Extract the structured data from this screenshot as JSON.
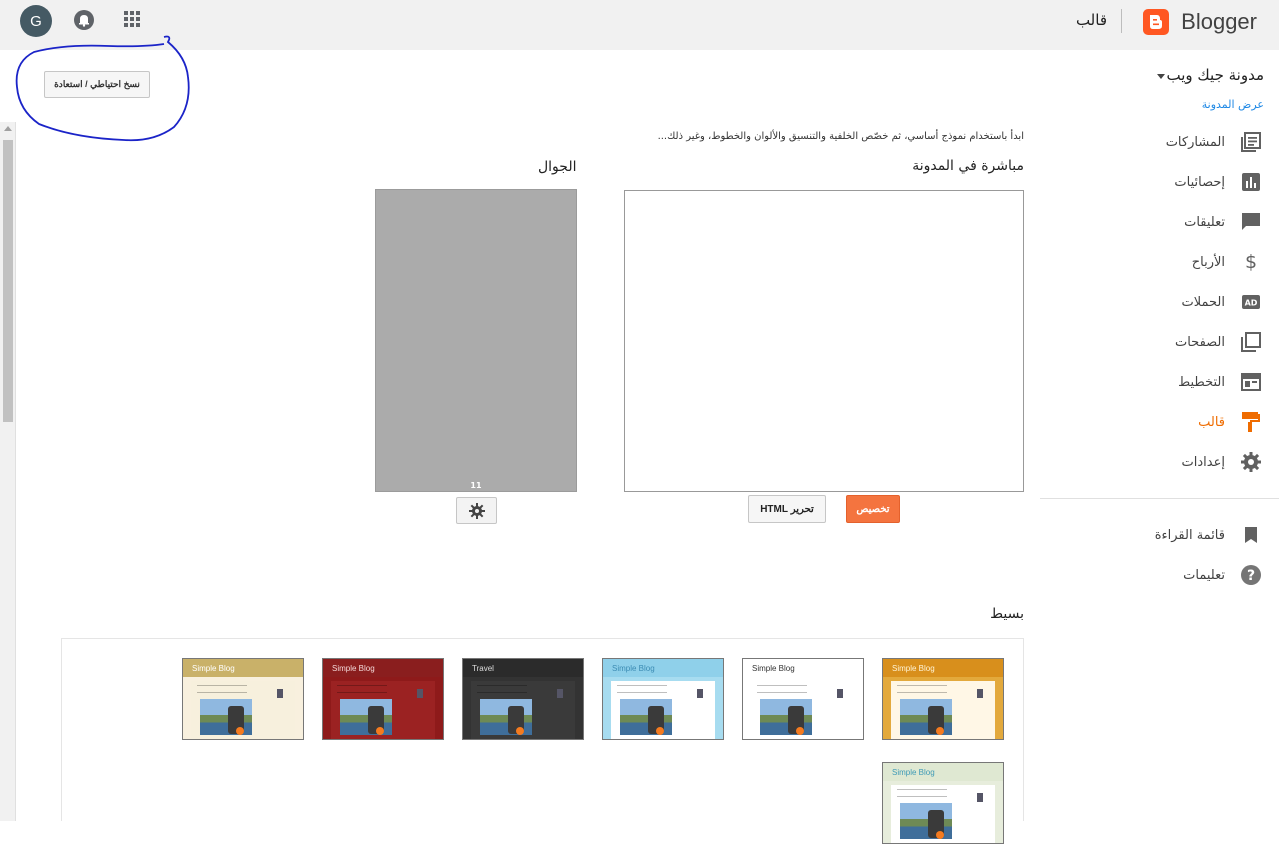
{
  "header": {
    "avatar_letter": "G",
    "brand": "Blogger",
    "page_title": "قالب"
  },
  "main": {
    "backup_button": "نسخ احتياطي / استعادة",
    "intro": "ابدأ باستخدام نموذج أساسي، ثم خصّص الخلفية والتنسيق والألوان والخطوط، وغير ذلك...",
    "live_title": "مباشرة في المدونة",
    "mobile_title": "الجوال",
    "mobile_page_number": "11",
    "customize_button": "تخصيص",
    "edit_html_button": "تحرير HTML",
    "simple_title": "بسيط"
  },
  "templates": [
    {
      "title": "Simple Blog",
      "head": "#c9b169",
      "body": "#f7f0dd",
      "page": "#f8f0de",
      "text": "#ffffff"
    },
    {
      "title": "Simple Blog",
      "head": "#8a1e1e",
      "body": "#9b2222",
      "page": "#8e1a1a",
      "text": "#f3d8d8"
    },
    {
      "title": "Travel",
      "head": "#2b2b2b",
      "body": "#3a3a3a",
      "page": "#333333",
      "text": "#dddddd"
    },
    {
      "title": "Simple Blog",
      "head": "#8fd0ea",
      "body": "#ffffff",
      "page": "#a7dcf0",
      "text": "#3c8cb4"
    },
    {
      "title": "Simple Blog",
      "head": "#ffffff",
      "body": "#ffffff",
      "page": "#ffffff",
      "text": "#333333"
    },
    {
      "title": "Simple Blog",
      "head": "#d88f1c",
      "body": "#fff7e6",
      "page": "#e3a93c",
      "text": "#fff4d6"
    },
    {
      "title": "Simple Blog",
      "head": "#dfe8d2",
      "body": "#ffffff",
      "page": "#e7eddc",
      "text": "#3e9ab6"
    }
  ],
  "sidebar": {
    "blog_name": "مدونة جيك ويب",
    "view_blog": "عرض المدونة",
    "nav": [
      {
        "label": "المشاركات",
        "icon": "posts-icon"
      },
      {
        "label": "إحصائيات",
        "icon": "stats-icon"
      },
      {
        "label": "تعليقات",
        "icon": "comments-icon"
      },
      {
        "label": "الأرباح",
        "icon": "earnings-icon"
      },
      {
        "label": "الحملات",
        "icon": "campaigns-icon"
      },
      {
        "label": "الصفحات",
        "icon": "pages-icon"
      },
      {
        "label": "التخطيط",
        "icon": "layout-icon"
      },
      {
        "label": "قالب",
        "icon": "theme-icon"
      },
      {
        "label": "إعدادات",
        "icon": "settings-icon"
      }
    ],
    "secondary": [
      {
        "label": "قائمة القراءة",
        "icon": "reading-list-icon"
      },
      {
        "label": "تعليمات",
        "icon": "help-icon"
      }
    ],
    "accent_color": "#ef6c00"
  }
}
